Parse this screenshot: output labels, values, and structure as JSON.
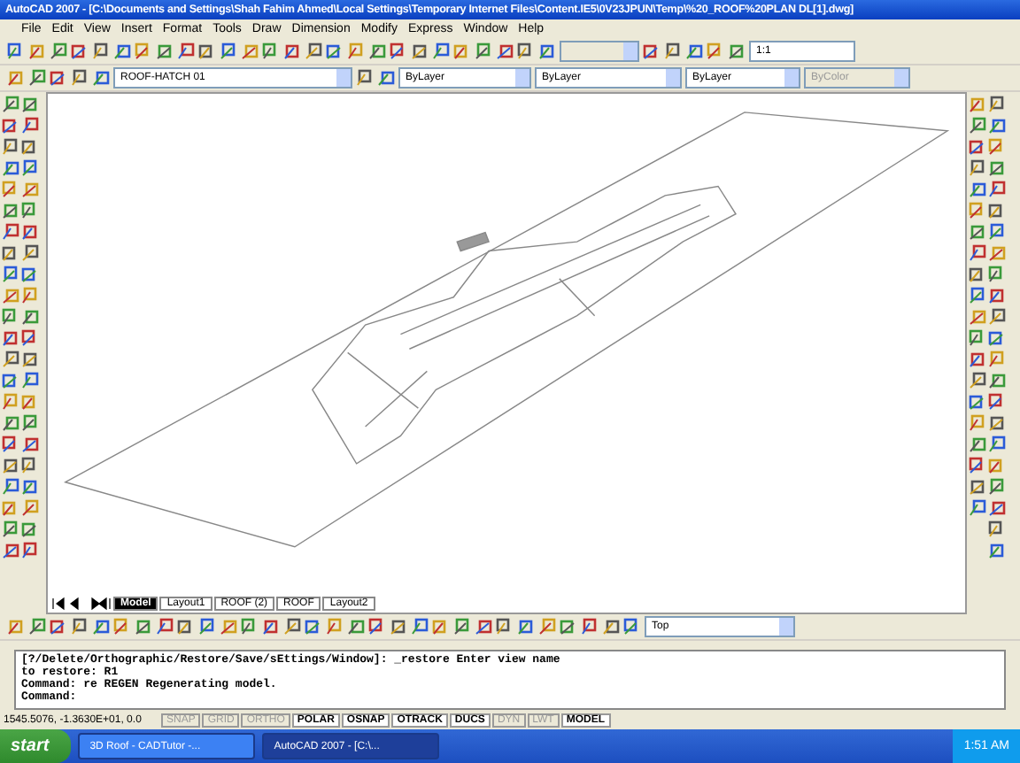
{
  "window": {
    "title": "AutoCAD 2007 - [C:\\Documents and Settings\\Shah Fahim Ahmed\\Local Settings\\Temporary Internet Files\\Content.IE5\\0V23JPUN\\Temp\\%20_ROOF%20PLAN DL[1].dwg]"
  },
  "menu": [
    "File",
    "Edit",
    "View",
    "Insert",
    "Format",
    "Tools",
    "Draw",
    "Dimension",
    "Modify",
    "Express",
    "Window",
    "Help"
  ],
  "toolbar": {
    "scale": "1:1"
  },
  "properties": {
    "layer": "ROOF-HATCH 01",
    "color_setting": "ByLayer",
    "linetype": "ByLayer",
    "lineweight": "ByLayer",
    "plotstyle": "ByColor"
  },
  "layout_tabs": [
    {
      "label": "Model",
      "selected": true
    },
    {
      "label": "Layout1",
      "selected": false
    },
    {
      "label": "ROOF (2)",
      "selected": false
    },
    {
      "label": "ROOF",
      "selected": false
    },
    {
      "label": "Layout2",
      "selected": false
    }
  ],
  "view_combo": "Top",
  "command_lines": [
    "[?/Delete/Orthographic/Restore/Save/sEttings/Window]:  _restore Enter view name",
    "to restore: R1",
    "Command: re REGEN Regenerating model.",
    "Command:"
  ],
  "status_bar": {
    "coordinates": "1545.5076, -1.3630E+01, 0.0",
    "toggles": [
      {
        "label": "SNAP",
        "on": false
      },
      {
        "label": "GRID",
        "on": false
      },
      {
        "label": "ORTHO",
        "on": false
      },
      {
        "label": "POLAR",
        "on": true
      },
      {
        "label": "OSNAP",
        "on": true
      },
      {
        "label": "OTRACK",
        "on": true
      },
      {
        "label": "DUCS",
        "on": true
      },
      {
        "label": "DYN",
        "on": false
      },
      {
        "label": "LWT",
        "on": false
      },
      {
        "label": "MODEL",
        "on": true
      }
    ]
  },
  "taskbar": {
    "start": "start",
    "tasks": [
      {
        "label": "3D Roof - CADTutor -...",
        "selected": false
      },
      {
        "label": "AutoCAD 2007 - [C:\\...",
        "selected": true
      }
    ],
    "clock": "1:51 AM"
  }
}
